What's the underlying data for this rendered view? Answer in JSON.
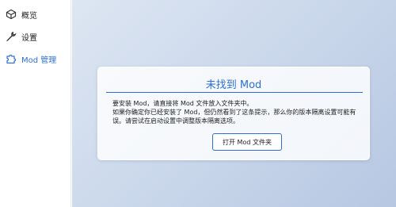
{
  "sidebar": {
    "items": [
      {
        "label": "概览",
        "icon": "cube-icon",
        "active": false
      },
      {
        "label": "设置",
        "icon": "wrench-icon",
        "active": false
      },
      {
        "label": "Mod 管理",
        "icon": "puzzle-icon",
        "active": true
      }
    ]
  },
  "card": {
    "title": "未找到 Mod",
    "lines": [
      "要安装 Mod，请直接将 Mod 文件放入文件夹中。",
      "如果你确定你已经安装了 Mod，但仍然看到了这条提示，那么你的版本隔离设置可能有误。请尝试在启动设置中调整版本隔离选项。"
    ],
    "button_label": "打开 Mod 文件夹"
  },
  "colors": {
    "accent": "#2d6fd6",
    "background_gradient_start": "#dde6f2",
    "background_gradient_end": "#b7c7e2"
  }
}
